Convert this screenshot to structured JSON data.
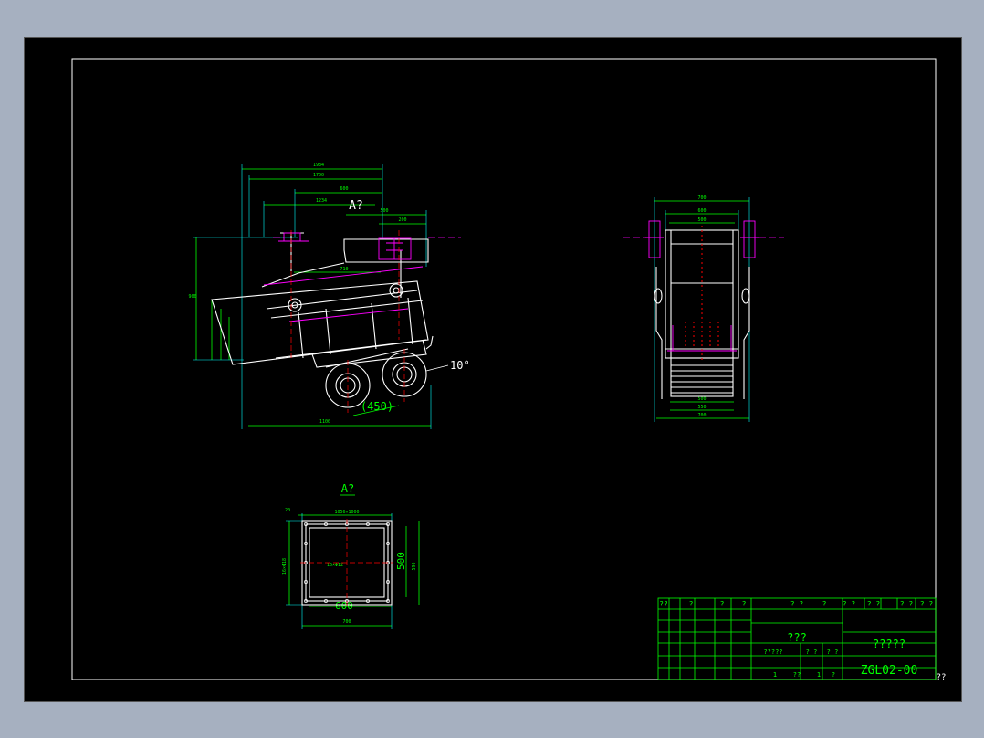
{
  "views": {
    "section_label": "A?",
    "detail_label": "A?",
    "angle_label": "10°",
    "offset_label": "(450)",
    "opening_width": "600",
    "opening_height": "500"
  },
  "title_block": {
    "header_marks": [
      "??",
      "?",
      "?",
      "?",
      "? ?",
      "?",
      "? ?",
      "? ?",
      "? ?",
      "? ?"
    ],
    "drawing_name": "???",
    "company_name": "?????",
    "drawing_number": "ZGL02-00",
    "sheet_mark": "??",
    "scale_row": [
      "?????",
      "? ?",
      "? ?"
    ],
    "bottom_row": [
      "1",
      "??",
      "1",
      "?"
    ]
  },
  "colors": {
    "background": "#000000",
    "frame": "#ffffff",
    "outline": "#ffffff",
    "dimension": "#00ff00",
    "extension": "#00ffff",
    "hidden": "#ff00ff",
    "centerline": "#ff0000",
    "text": "#00ff00"
  }
}
